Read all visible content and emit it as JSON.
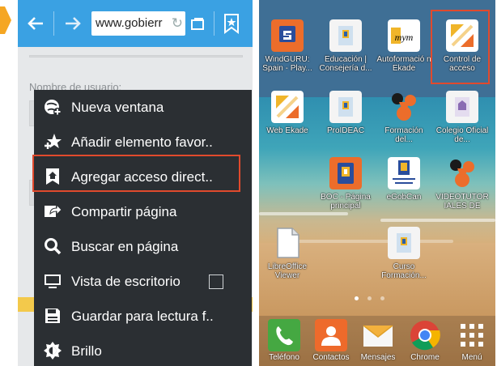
{
  "colors": {
    "accent_orange": "#f5a623",
    "toolbar_blue": "#3aa1e3",
    "menu_bg": "#2b2f33",
    "highlight_red": "#e14a2d"
  },
  "browser": {
    "back_icon": "back-arrow-icon",
    "forward_icon": "forward-arrow-icon",
    "url": "www.gobierr",
    "tabs_icon": "tabs-icon",
    "bookmark_icon": "bookmark-star-icon",
    "page_fragment_top": "...",
    "page_fragment_label": "Nombre de usuario:"
  },
  "menu": {
    "items": [
      {
        "label": "Nueva ventana",
        "icon": "new-window-globe-icon"
      },
      {
        "label": "Añadir elemento favor..",
        "icon": "add-favorite-star-icon"
      },
      {
        "label": "Agregar acceso direct..",
        "icon": "add-shortcut-icon"
      },
      {
        "label": "Compartir página",
        "icon": "share-icon"
      },
      {
        "label": "Buscar en página",
        "icon": "search-icon"
      },
      {
        "label": "Vista de escritorio",
        "icon": "desktop-monitor-icon",
        "checkbox": false
      },
      {
        "label": "Guardar para lectura f..",
        "icon": "save-icon"
      },
      {
        "label": "Brillo",
        "icon": "brightness-icon"
      }
    ]
  },
  "home": {
    "apps": [
      {
        "label": "WindGURU: Spain - Play...",
        "icon": "windguru-icon"
      },
      {
        "label": "Educación | Consejería d...",
        "icon": "education-icon"
      },
      {
        "label": "Autoformació n Ekade",
        "icon": "mym-icon"
      },
      {
        "label": "Control de acceso",
        "icon": "control-acceso-icon"
      },
      {
        "label": "Web Ekade",
        "icon": "web-ekade-icon"
      },
      {
        "label": "ProIDEAC",
        "icon": "proideac-icon"
      },
      {
        "label": "Formación del...",
        "icon": "formacion-icon"
      },
      {
        "label": "Colegio Oficial de...",
        "icon": "colegio-icon"
      },
      {
        "label": "BOC - Página principal",
        "icon": "boc-icon"
      },
      {
        "label": "eGobCan",
        "icon": "egobcan-icon"
      },
      {
        "label": "VIDEOTUTOR IALES DE",
        "icon": "videotutoriales-icon"
      },
      {
        "label": "LibreOffice Viewer",
        "icon": "libreoffice-icon"
      },
      {
        "label": "Curso Formación...",
        "icon": "curso-formacion-icon"
      }
    ],
    "dock": [
      {
        "label": "Teléfono",
        "icon": "phone-icon"
      },
      {
        "label": "Contactos",
        "icon": "contacts-icon"
      },
      {
        "label": "Mensajes",
        "icon": "messages-icon"
      },
      {
        "label": "Chrome",
        "icon": "chrome-icon"
      },
      {
        "label": "Menú",
        "icon": "app-menu-grid-icon"
      }
    ]
  }
}
